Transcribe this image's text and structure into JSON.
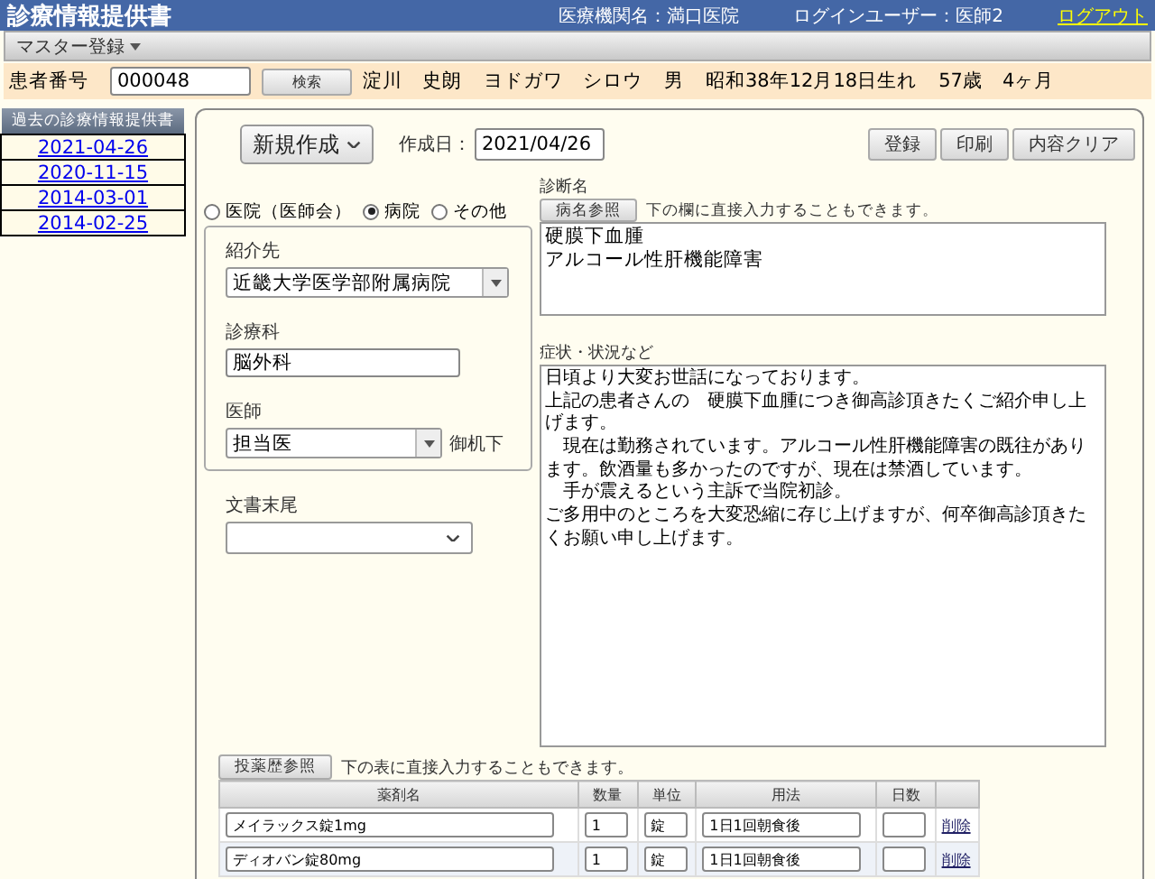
{
  "header": {
    "title": "診療情報提供書",
    "institution": "医療機関名：満口医院",
    "login_user": "ログインユーザー：医師2",
    "logout": "ログアウト"
  },
  "menu": {
    "items": [
      "マスター登録"
    ]
  },
  "patient": {
    "label": "患者番号",
    "number": "000048",
    "search_button": "検索",
    "fields": [
      "淀川　史朗",
      "ヨドガワ　シロウ",
      "男",
      "昭和38年12月18日生れ",
      "57歳　4ヶ月"
    ]
  },
  "history": {
    "title": "過去の診療情報提供書",
    "dates": [
      "2021-04-26",
      "2020-11-15",
      "2014-03-01",
      "2014-02-25"
    ]
  },
  "form": {
    "new_button": "新規作成",
    "date_label": "作成日：",
    "date": "2021/04/26",
    "actions": [
      "登録",
      "印刷",
      "内容クリア"
    ],
    "facility_types": [
      {
        "label": "医院（医師会）",
        "selected": false
      },
      {
        "label": "病院",
        "selected": true
      },
      {
        "label": "その他",
        "selected": false
      }
    ],
    "referral_label": "紹介先",
    "referral": "近畿大学医学部附属病院",
    "department_label": "診療科",
    "department": "脳外科",
    "doctor_label": "医師",
    "doctor": "担当医",
    "honorific": "御机下",
    "footer_label": "文書末尾",
    "diagnosis_label": "診断名",
    "diagnosis_button": "病名参照",
    "diagnosis_hint": "下の欄に直接入力することもできます。",
    "diagnosis": [
      "硬膜下血腫",
      "アルコール性肝機能障害"
    ],
    "symptoms_label": "症状・状況など",
    "symptoms": [
      "日頃より大変お世話になっております。",
      "上記の患者さんの　硬膜下血腫につき御高診頂きたくご紹介申し上げます。",
      "　現在は勤務されています。アルコール性肝機能障害の既往があります。飲酒量も多かったのですが、現在は禁酒しています。",
      "　手が震えるという主訴で当院初診。",
      "ご多用中のところを大変恐縮に存じ上げますが、何卒御高診頂きたくお願い申し上げます。"
    ],
    "medication_button": "投薬歴参照",
    "medication_hint": "下の表に直接入力することもできます。",
    "medication_columns": [
      "薬剤名",
      "数量",
      "単位",
      "用法",
      "日数"
    ],
    "medications": [
      {
        "name": "メイラックス錠1mg",
        "quantity": "1",
        "unit": "錠",
        "usage": "1日1回朝食後",
        "delete": "削除"
      },
      {
        "name": "ディオバン錠80mg",
        "quantity": "1",
        "unit": "錠",
        "usage": "1日1回朝食後",
        "delete": "削除"
      }
    ]
  }
}
